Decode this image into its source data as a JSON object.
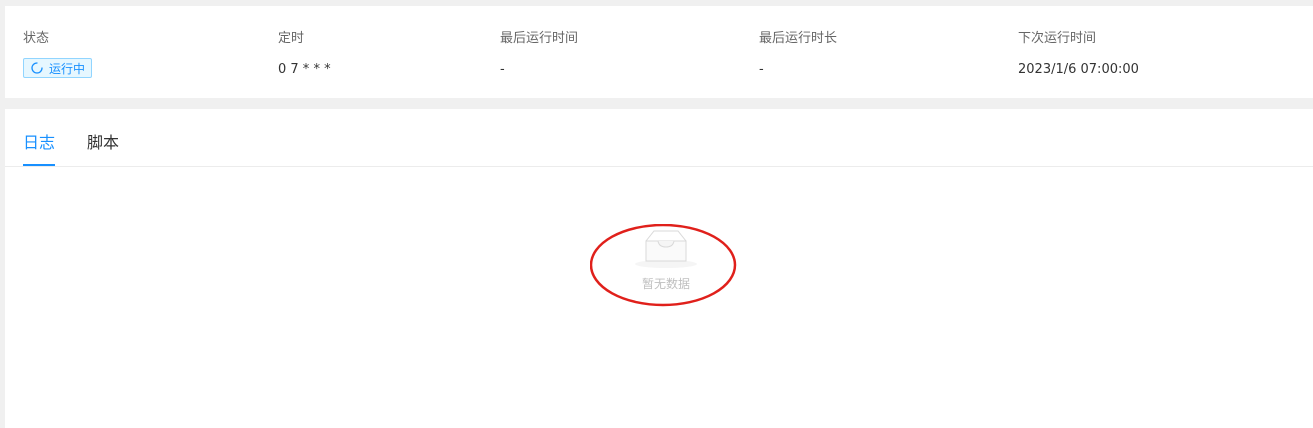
{
  "summary": {
    "columns": [
      {
        "label": "状态"
      },
      {
        "label": "定时",
        "value": "0 7 * * *"
      },
      {
        "label": "最后运行时间",
        "value": "-"
      },
      {
        "label": "最后运行时长",
        "value": "-"
      },
      {
        "label": "下次运行时间",
        "value": "2023/1/6 07:00:00"
      }
    ],
    "status_tag": {
      "label": "运行中",
      "icon": "sync-icon",
      "color": "#1890ff"
    }
  },
  "tabs": [
    {
      "label": "日志",
      "active": true
    },
    {
      "label": "脚本",
      "active": false
    }
  ],
  "empty_state": {
    "icon": "empty-inbox-icon",
    "text": "暂无数据"
  },
  "colors": {
    "accent": "#1890ff",
    "annotation": "#e0201b"
  }
}
